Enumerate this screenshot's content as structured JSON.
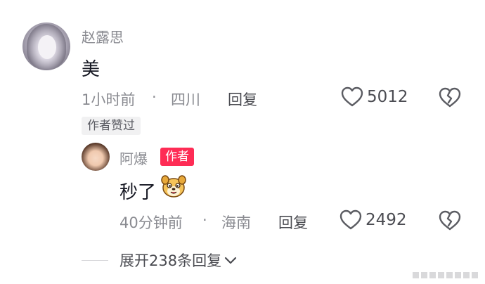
{
  "comment": {
    "username": "赵露思",
    "text": "美",
    "time": "1小时前",
    "location": "四川",
    "reply_label": "回复",
    "likes": "5012",
    "author_liked_badge": "作者赞过"
  },
  "reply": {
    "username": "阿爆",
    "author_tag": "作者",
    "text": "秒了",
    "emoji_name": "dog-sticker-emoji",
    "time": "40分钟前",
    "location": "海南",
    "reply_label": "回复",
    "likes": "2492"
  },
  "expand": {
    "label": "展开238条回复"
  },
  "colors": {
    "accent_red": "#fe2c55",
    "secondary_text": "#8a8b91",
    "primary_text": "#161823"
  }
}
